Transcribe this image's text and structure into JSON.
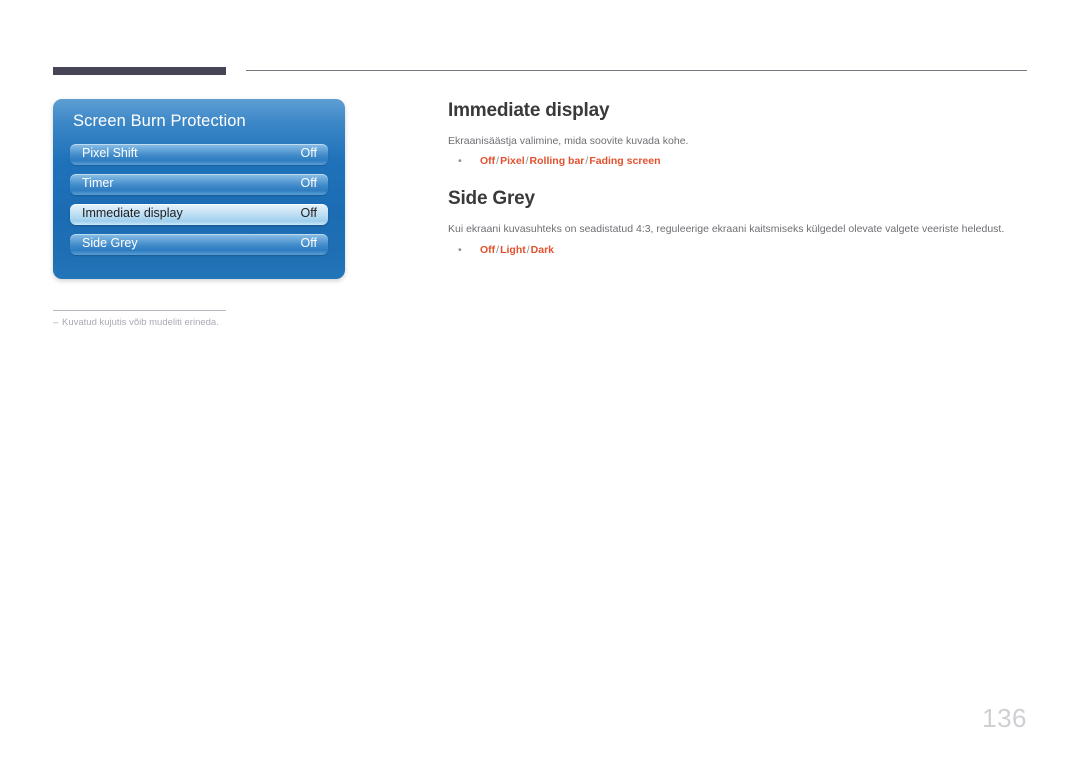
{
  "page": {
    "number": "136"
  },
  "osd": {
    "title": "Screen Burn Protection",
    "rows": [
      {
        "label": "Pixel Shift",
        "value": "Off",
        "selected": false
      },
      {
        "label": "Timer",
        "value": "Off",
        "selected": false
      },
      {
        "label": "Immediate display",
        "value": "Off",
        "selected": true
      },
      {
        "label": "Side Grey",
        "value": "Off",
        "selected": false
      }
    ]
  },
  "footnote": {
    "dash": "–",
    "text": "Kuvatud kujutis võib mudeliti erineda."
  },
  "sections": [
    {
      "heading": "Immediate display",
      "description": "Ekraanisäästja valimine, mida soovite kuvada kohe.",
      "bullet": "•",
      "options": [
        "Off",
        "Pixel",
        "Rolling bar",
        "Fading screen"
      ],
      "separator": "/"
    },
    {
      "heading": "Side Grey",
      "description": "Kui ekraani kuvasuhteks on seadistatud 4:3, reguleerige ekraani kaitsmiseks külgedel olevate valgete veeriste heledust.",
      "bullet": "•",
      "options": [
        "Off",
        "Light",
        "Dark"
      ],
      "separator": "/"
    }
  ],
  "colors": {
    "accent_orange": "#e1512e",
    "heading_gray": "#3a3a3c",
    "rule_dark": "#464557",
    "osd_blue": "#1f72ba",
    "page_number_gray": "#cfcfd4"
  }
}
